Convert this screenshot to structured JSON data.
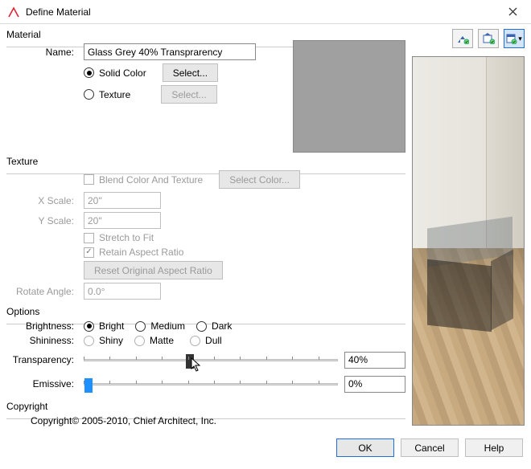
{
  "window": {
    "title": "Define Material"
  },
  "material": {
    "legend": "Material",
    "name_label": "Name:",
    "name_value": "Glass Grey 40% Transprarency",
    "solid_label": "Solid Color",
    "texture_label": "Texture",
    "select1": "Select...",
    "select2": "Select..."
  },
  "texture": {
    "legend": "Texture",
    "blend_label": "Blend Color And Texture",
    "select_color": "Select Color...",
    "xscale_label": "X Scale:",
    "xscale_value": "20\"",
    "yscale_label": "Y Scale:",
    "yscale_value": "20\"",
    "stretch_label": "Stretch to Fit",
    "retain_label": "Retain Aspect Ratio",
    "reset_label": "Reset Original Aspect Ratio",
    "rotate_label": "Rotate Angle:",
    "rotate_value": "0.0°"
  },
  "options": {
    "legend": "Options",
    "brightness_label": "Brightness:",
    "bright": "Bright",
    "medium": "Medium",
    "dark": "Dark",
    "shininess_label": "Shininess:",
    "shiny": "Shiny",
    "matte": "Matte",
    "dull": "Dull",
    "transparency_label": "Transparency:",
    "transparency_value": "40%",
    "transparency_pct": 40,
    "emissive_label": "Emissive:",
    "emissive_value": "0%",
    "emissive_pct": 0
  },
  "copyright": {
    "legend": "Copyright",
    "text": "Copyright© 2005-2010, Chief Architect, Inc."
  },
  "buttons": {
    "ok": "OK",
    "cancel": "Cancel",
    "help": "Help"
  },
  "swatch_color": "#a0a0a0"
}
